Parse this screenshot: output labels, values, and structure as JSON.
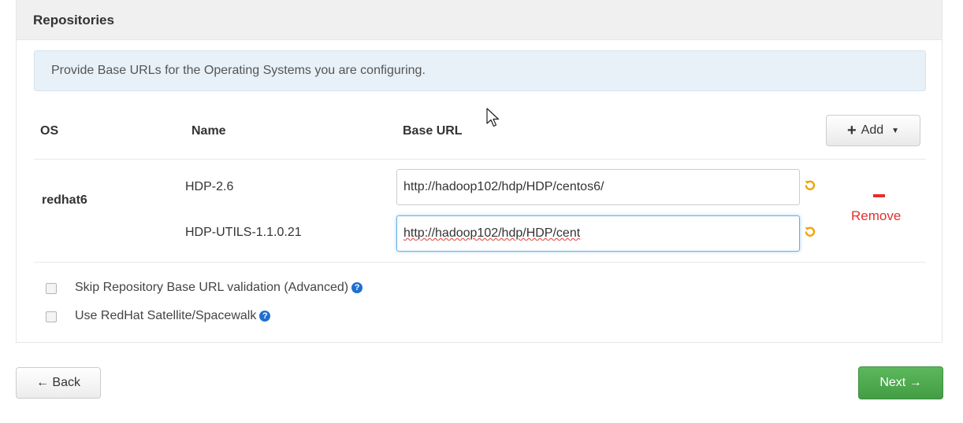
{
  "panel": {
    "title": "Repositories",
    "info_text": "Provide Base URLs for the Operating Systems you are configuring."
  },
  "table": {
    "headers": {
      "os": "OS",
      "name": "Name",
      "base_url": "Base URL"
    },
    "add_button_label": "Add",
    "rows": [
      {
        "os": "redhat6",
        "repos": [
          {
            "name": "HDP-2.6",
            "url": "http://hadoop102/hdp/HDP/centos6/"
          },
          {
            "name": "HDP-UTILS-1.1.0.21",
            "url": "http://hadoop102/hdp/HDP/cent"
          }
        ],
        "remove_label": "Remove"
      }
    ]
  },
  "options": {
    "skip_validation_label": "Skip Repository Base URL validation (Advanced)",
    "satellite_label": "Use RedHat Satellite/Spacewalk"
  },
  "nav": {
    "back_label": "← Back",
    "next_label": "Next →"
  },
  "icons": {
    "add": "plus-icon",
    "dropdown": "caret-down-icon",
    "undo": "undo-icon",
    "remove": "minus-icon",
    "help": "question-circle-icon"
  },
  "colors": {
    "remove": "#e2302e",
    "next_button": "#5cb85c",
    "undo_icon": "#f0a30a",
    "help_icon": "#1f6fd1",
    "info_background": "#e8f1f7"
  }
}
